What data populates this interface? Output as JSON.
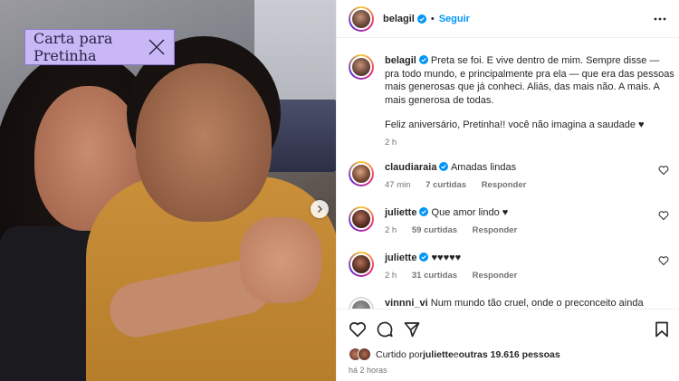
{
  "photo": {
    "sticker_text": "Carta para Pretinha"
  },
  "header": {
    "username": "belagil",
    "separator": "•",
    "follow_label": "Seguir"
  },
  "caption": {
    "username": "belagil",
    "text": "Preta se foi. E vive dentro de mim. Sempre disse — pra todo mundo, e principalmente pra ela — que era das pessoas mais generosas que já conheci. Aliás, das mais não. A mais. A mais generosa de todas.",
    "text2": "Feliz aniversário, Pretinha!! você não imagina a saudade ♥",
    "time": "2 h"
  },
  "comments": [
    {
      "username": "claudiaraia",
      "text": "Amadas lindas",
      "time": "47 min",
      "likes": "7 curtidas",
      "reply": "Responder"
    },
    {
      "username": "juliette",
      "text": "Que amor lindo ♥",
      "time": "2 h",
      "likes": "59 curtidas",
      "reply": "Responder"
    },
    {
      "username": "juliette",
      "text": "♥♥♥♥♥",
      "time": "2 h",
      "likes": "31 curtidas",
      "reply": "Responder"
    },
    {
      "username": "vinnni_vi",
      "text": "Num mundo tão cruel, onde o preconceito ainda"
    }
  ],
  "likes": {
    "prefix": "Curtido por ",
    "user": "juliette",
    "middle": " e ",
    "others": "outras 19.616 pessoas"
  },
  "post_time": "há 2 horas",
  "colors": {
    "accent": "#0095f6",
    "sticker_bg": "#c9b8f5",
    "sweater": "#c98f39"
  }
}
